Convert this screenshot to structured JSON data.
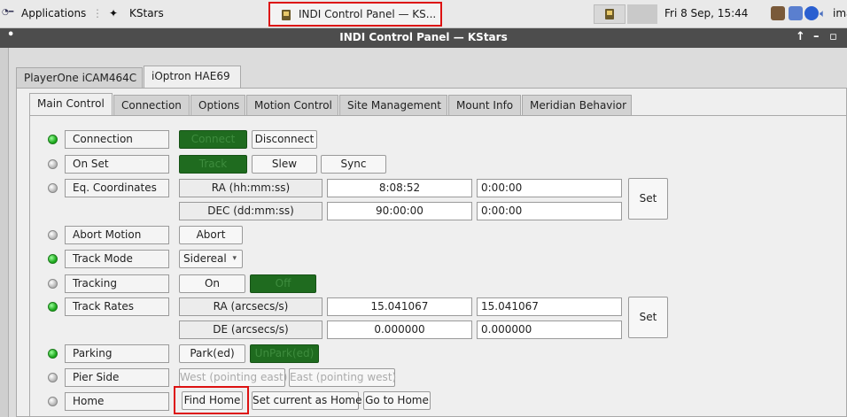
{
  "sysbar": {
    "apps_label": "Applications",
    "task_kstars": "KStars",
    "task_indi": "INDI Control Panel — KS...",
    "clock": "Fri  8 Sep, 15:44",
    "trailing": "ima"
  },
  "window": {
    "title": "INDI Control Panel — KStars"
  },
  "device_tabs": [
    "PlayerOne iCAM464C",
    "iOptron HAE69"
  ],
  "group_tabs": [
    "Main Control",
    "Connection",
    "Options",
    "Motion Control",
    "Site Management",
    "Mount Info",
    "Meridian Behavior"
  ],
  "rows": {
    "connection": {
      "label": "Connection",
      "connect": "Connect",
      "disconnect": "Disconnect"
    },
    "on_set": {
      "label": "On Set",
      "track": "Track",
      "slew": "Slew",
      "sync": "Sync"
    },
    "eq": {
      "label": "Eq. Coordinates",
      "ra_label": "RA (hh:mm:ss)",
      "ra_value": "8:08:52",
      "ra_input": "0:00:00",
      "dec_label": "DEC (dd:mm:ss)",
      "dec_value": "90:00:00",
      "dec_input": "0:00:00",
      "set": "Set"
    },
    "abort": {
      "label": "Abort Motion",
      "button": "Abort"
    },
    "track_mode": {
      "label": "Track Mode",
      "value": "Sidereal"
    },
    "tracking": {
      "label": "Tracking",
      "on": "On",
      "off": "Off"
    },
    "track_rates": {
      "label": "Track Rates",
      "ra_label": "RA (arcsecs/s)",
      "ra_value": "15.041067",
      "ra_input": "15.041067",
      "de_label": "DE (arcsecs/s)",
      "de_value": "0.000000",
      "de_input": "0.000000",
      "set": "Set"
    },
    "parking": {
      "label": "Parking",
      "park": "Park(ed)",
      "unpark": "UnPark(ed)"
    },
    "pier_side": {
      "label": "Pier Side",
      "west": "West (pointing east)",
      "east": "East (pointing west)"
    },
    "home": {
      "label": "Home",
      "find": "Find Home",
      "set_current": "Set current as Home",
      "goto": "Go to Home"
    }
  },
  "colors": {
    "active_green": "#1f6b1f",
    "highlight_red": "#dd1111",
    "titlebar": "#4d4d4d"
  }
}
